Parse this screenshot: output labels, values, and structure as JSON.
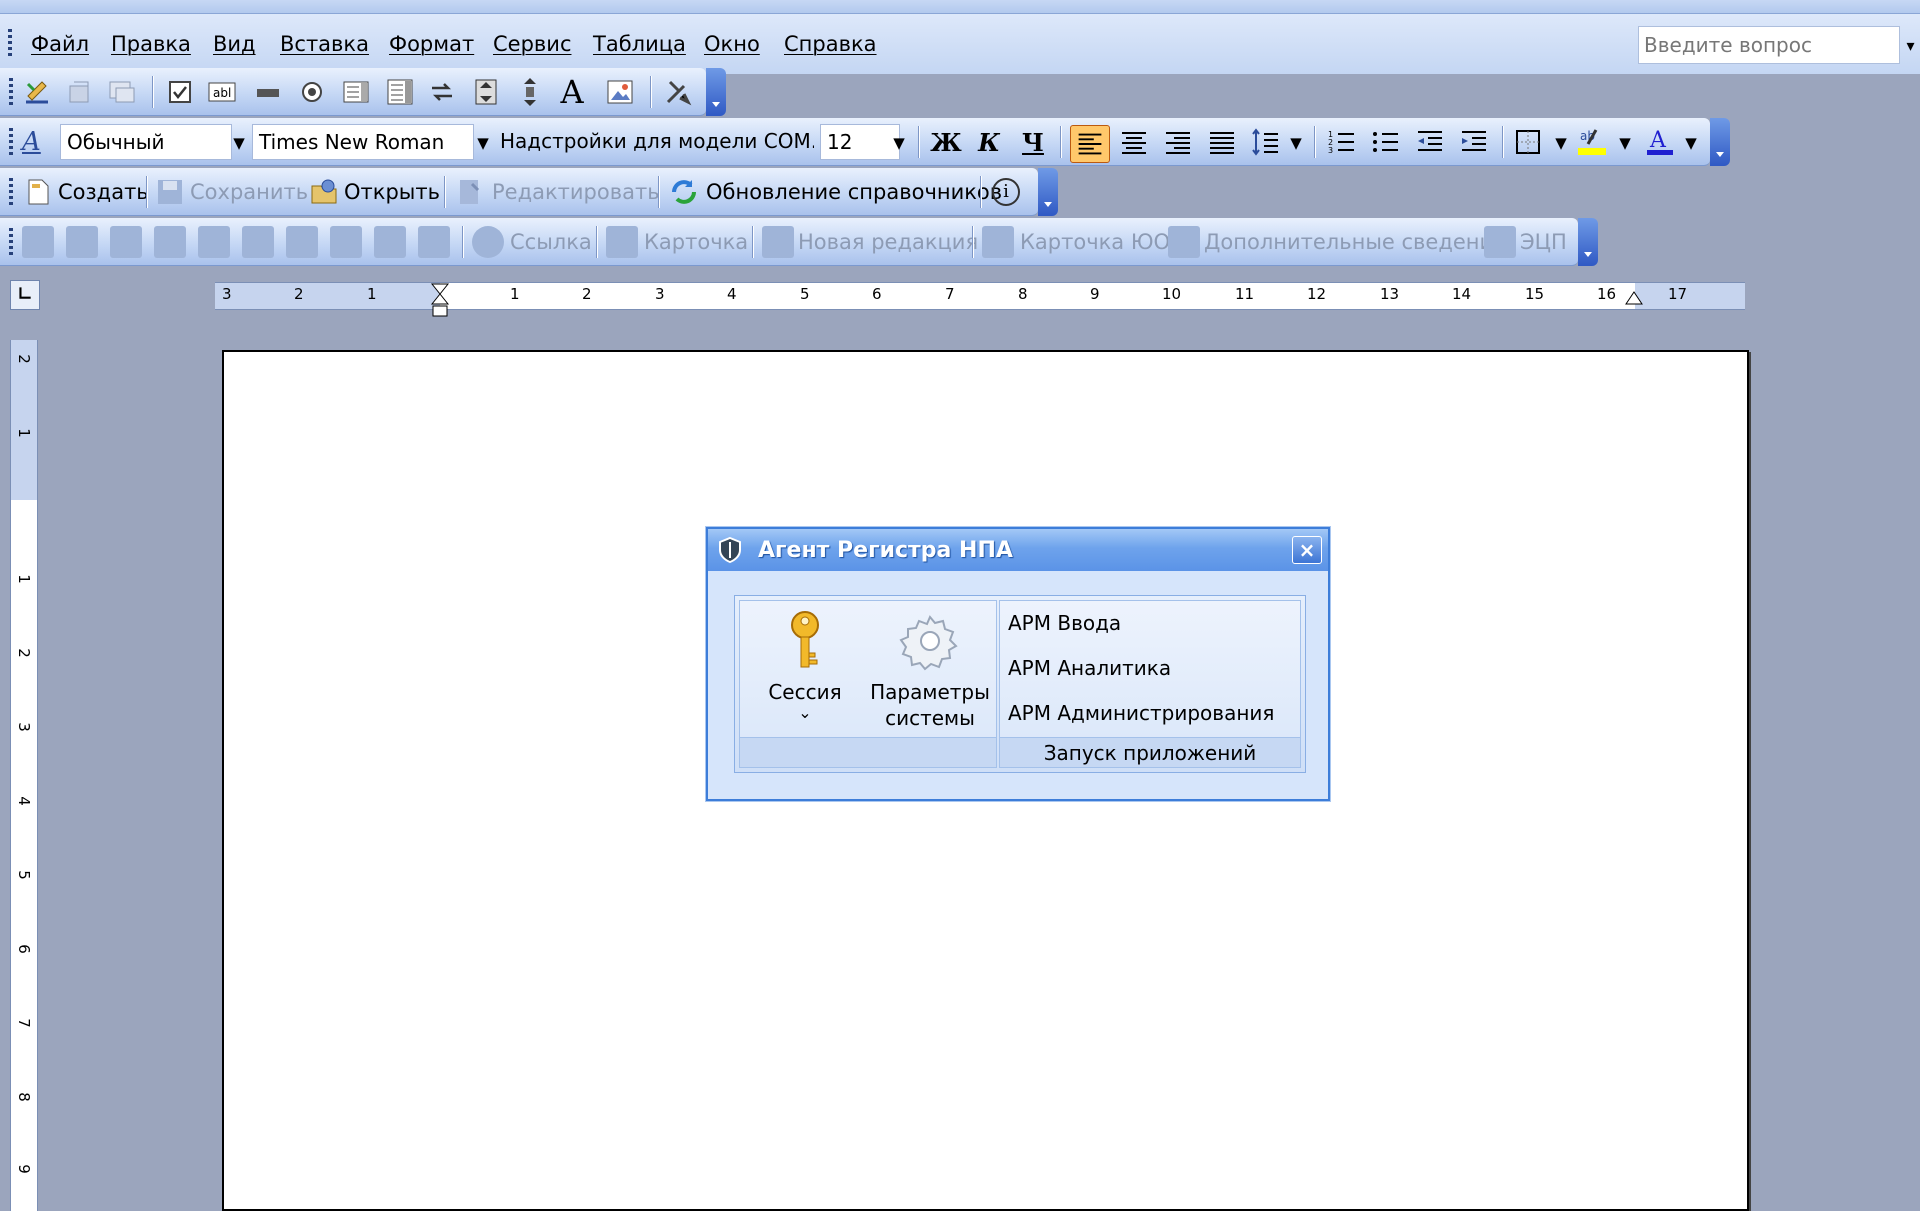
{
  "menu": {
    "items": [
      "Файл",
      "Правка",
      "Вид",
      "Вставка",
      "Формат",
      "Сервис",
      "Таблица",
      "Окно",
      "Справка"
    ],
    "help_placeholder": "Введите вопрос"
  },
  "formatting": {
    "style": "Обычный",
    "font": "Times New Roman",
    "addins": "Надстройки для модели COM...",
    "size": "12",
    "bold": "Ж",
    "italic": "К",
    "underline": "Ч",
    "highlight_color": "#ffff00",
    "font_color": "#2020d0"
  },
  "npa_toolbar": {
    "create": "Создать",
    "save": "Сохранить",
    "open": "Открыть",
    "edit": "Редактировать",
    "update_refs": "Обновление справочников",
    "info": "i"
  },
  "doc_toolbar": {
    "link": "Ссылка",
    "card": "Карточка",
    "new_edition": "Новая редакция",
    "card_yuo": "Карточка ЮО",
    "extra_info": "Дополнительные сведения",
    "ecp": "ЭЦП"
  },
  "ruler": {
    "h_labels": [
      "3",
      "2",
      "1",
      "1",
      "2",
      "3",
      "4",
      "5",
      "6",
      "7",
      "8",
      "9",
      "10",
      "11",
      "12",
      "13",
      "14",
      "15",
      "16",
      "17"
    ],
    "v_labels": [
      "2",
      "1",
      "1",
      "2",
      "3",
      "4",
      "5",
      "6",
      "7",
      "8",
      "9"
    ]
  },
  "dialog": {
    "title": "Агент Регистра НПА",
    "close": "×",
    "session_label": "Сессия",
    "session_arrow": "⌄",
    "params_label_1": "Параметры",
    "params_label_2": "системы",
    "apps": [
      "АРМ Ввода",
      "АРМ Аналитика",
      "АРМ Администрирования"
    ],
    "apps_caption": "Запуск приложений"
  }
}
